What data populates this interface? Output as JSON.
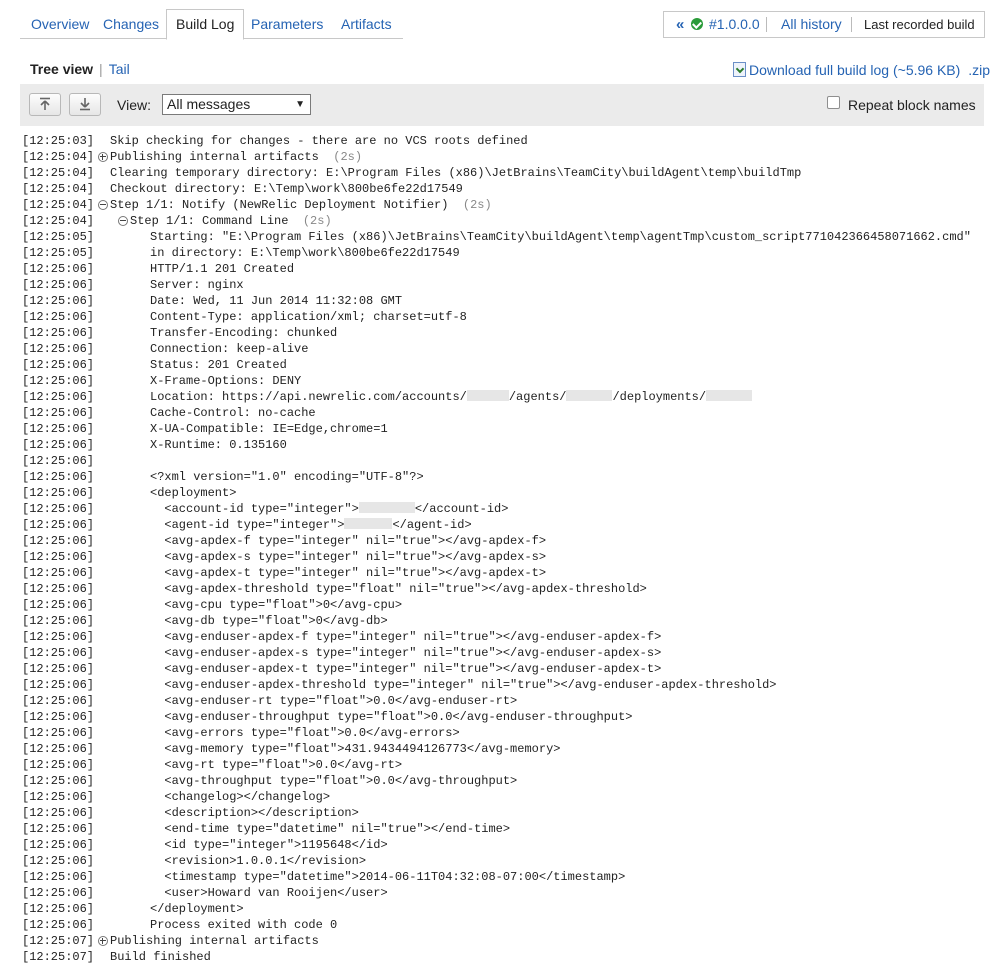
{
  "tabs": [
    {
      "label": "Overview"
    },
    {
      "label": "Changes"
    },
    {
      "label": "Build Log"
    },
    {
      "label": "Parameters"
    },
    {
      "label": "Artifacts"
    }
  ],
  "build_nav": {
    "build_number": "#1.0.0.0",
    "all_history": "All history",
    "last_recorded": "Last recorded build"
  },
  "view_switch": {
    "tree": "Tree view",
    "separator": "|",
    "tail": "Tail"
  },
  "download": {
    "label": "Download full build log (~5.96 KB)",
    "zip": ".zip"
  },
  "toolbar": {
    "view_label": "View:",
    "view_selected": "All messages",
    "repeat_block_names": "Repeat block names"
  },
  "log": [
    {
      "ts": "[12:25:03]",
      "text": "Skip checking for changes - there are no VCS roots defined"
    },
    {
      "ts": "[12:25:04]",
      "text": "Publishing internal artifacts",
      "dur": "(2s)",
      "toggle": "plus"
    },
    {
      "ts": "[12:25:04]",
      "text": "Clearing temporary directory: E:\\Program Files (x86)\\JetBrains\\TeamCity\\buildAgent\\temp\\buildTmp"
    },
    {
      "ts": "[12:25:04]",
      "text": "Checkout directory: E:\\Temp\\work\\800be6fe22d17549"
    },
    {
      "ts": "[12:25:04]",
      "text": "Step 1/1: Notify (NewRelic Deployment Notifier)",
      "dur": "(2s)",
      "toggle": "minus"
    },
    {
      "ts": "[12:25:04]",
      "text": "Step 1/1: Command Line",
      "dur": "(2s)",
      "toggle": "minus"
    },
    {
      "ts": "[12:25:05]",
      "text": "Starting: \"E:\\Program Files (x86)\\JetBrains\\TeamCity\\buildAgent\\temp\\agentTmp\\custom_script771042366458071662.cmd\""
    },
    {
      "ts": "[12:25:05]",
      "text": "in directory: E:\\Temp\\work\\800be6fe22d17549"
    },
    {
      "ts": "[12:25:06]",
      "text": "HTTP/1.1 201 Created"
    },
    {
      "ts": "[12:25:06]",
      "text": "Server: nginx"
    },
    {
      "ts": "[12:25:06]",
      "text": "Date: Wed, 11 Jun 2014 11:32:08 GMT"
    },
    {
      "ts": "[12:25:06]",
      "text": "Content-Type: application/xml; charset=utf-8"
    },
    {
      "ts": "[12:25:06]",
      "text": "Transfer-Encoding: chunked"
    },
    {
      "ts": "[12:25:06]",
      "text": "Connection: keep-alive"
    },
    {
      "ts": "[12:25:06]",
      "text": "Status: 201 Created"
    },
    {
      "ts": "[12:25:06]",
      "text": "X-Frame-Options: DENY"
    },
    {
      "ts": "[12:25:06]",
      "parts": [
        "Location: https://api.newrelic.com/accounts/",
        "/agents/",
        "/deployments/",
        ""
      ]
    },
    {
      "ts": "[12:25:06]",
      "text": "Cache-Control: no-cache"
    },
    {
      "ts": "[12:25:06]",
      "text": "X-UA-Compatible: IE=Edge,chrome=1"
    },
    {
      "ts": "[12:25:06]",
      "text": "X-Runtime: 0.135160"
    },
    {
      "ts": "[12:25:06]",
      "text": ""
    },
    {
      "ts": "[12:25:06]",
      "text": "<?xml version=\"1.0\" encoding=\"UTF-8\"?>"
    },
    {
      "ts": "[12:25:06]",
      "text": "<deployment>"
    },
    {
      "ts": "[12:25:06]",
      "parts": [
        "  <account-id type=\"integer\">",
        "</account-id>"
      ]
    },
    {
      "ts": "[12:25:06]",
      "parts": [
        "  <agent-id type=\"integer\">",
        "</agent-id>"
      ]
    },
    {
      "ts": "[12:25:06]",
      "text": "  <avg-apdex-f type=\"integer\" nil=\"true\"></avg-apdex-f>"
    },
    {
      "ts": "[12:25:06]",
      "text": "  <avg-apdex-s type=\"integer\" nil=\"true\"></avg-apdex-s>"
    },
    {
      "ts": "[12:25:06]",
      "text": "  <avg-apdex-t type=\"integer\" nil=\"true\"></avg-apdex-t>"
    },
    {
      "ts": "[12:25:06]",
      "text": "  <avg-apdex-threshold type=\"float\" nil=\"true\"></avg-apdex-threshold>"
    },
    {
      "ts": "[12:25:06]",
      "text": "  <avg-cpu type=\"float\">0</avg-cpu>"
    },
    {
      "ts": "[12:25:06]",
      "text": "  <avg-db type=\"float\">0</avg-db>"
    },
    {
      "ts": "[12:25:06]",
      "text": "  <avg-enduser-apdex-f type=\"integer\" nil=\"true\"></avg-enduser-apdex-f>"
    },
    {
      "ts": "[12:25:06]",
      "text": "  <avg-enduser-apdex-s type=\"integer\" nil=\"true\"></avg-enduser-apdex-s>"
    },
    {
      "ts": "[12:25:06]",
      "text": "  <avg-enduser-apdex-t type=\"integer\" nil=\"true\"></avg-enduser-apdex-t>"
    },
    {
      "ts": "[12:25:06]",
      "text": "  <avg-enduser-apdex-threshold type=\"integer\" nil=\"true\"></avg-enduser-apdex-threshold>"
    },
    {
      "ts": "[12:25:06]",
      "text": "  <avg-enduser-rt type=\"float\">0.0</avg-enduser-rt>"
    },
    {
      "ts": "[12:25:06]",
      "text": "  <avg-enduser-throughput type=\"float\">0.0</avg-enduser-throughput>"
    },
    {
      "ts": "[12:25:06]",
      "text": "  <avg-errors type=\"float\">0.0</avg-errors>"
    },
    {
      "ts": "[12:25:06]",
      "text": "  <avg-memory type=\"float\">431.9434494126773</avg-memory>"
    },
    {
      "ts": "[12:25:06]",
      "text": "  <avg-rt type=\"float\">0.0</avg-rt>"
    },
    {
      "ts": "[12:25:06]",
      "text": "  <avg-throughput type=\"float\">0.0</avg-throughput>"
    },
    {
      "ts": "[12:25:06]",
      "text": "  <changelog></changelog>"
    },
    {
      "ts": "[12:25:06]",
      "text": "  <description></description>"
    },
    {
      "ts": "[12:25:06]",
      "text": "  <end-time type=\"datetime\" nil=\"true\"></end-time>"
    },
    {
      "ts": "[12:25:06]",
      "text": "  <id type=\"integer\">1195648</id>"
    },
    {
      "ts": "[12:25:06]",
      "text": "  <revision>1.0.0.1</revision>"
    },
    {
      "ts": "[12:25:06]",
      "text": "  <timestamp type=\"datetime\">2014-06-11T04:32:08-07:00</timestamp>"
    },
    {
      "ts": "[12:25:06]",
      "text": "  <user>Howard van Rooijen</user>"
    },
    {
      "ts": "[12:25:06]",
      "text": "</deployment>"
    },
    {
      "ts": "[12:25:06]",
      "text": "Process exited with code 0"
    },
    {
      "ts": "[12:25:07]",
      "text": "Publishing internal artifacts",
      "toggle": "plus"
    },
    {
      "ts": "[12:25:07]",
      "text": "Build finished"
    }
  ]
}
